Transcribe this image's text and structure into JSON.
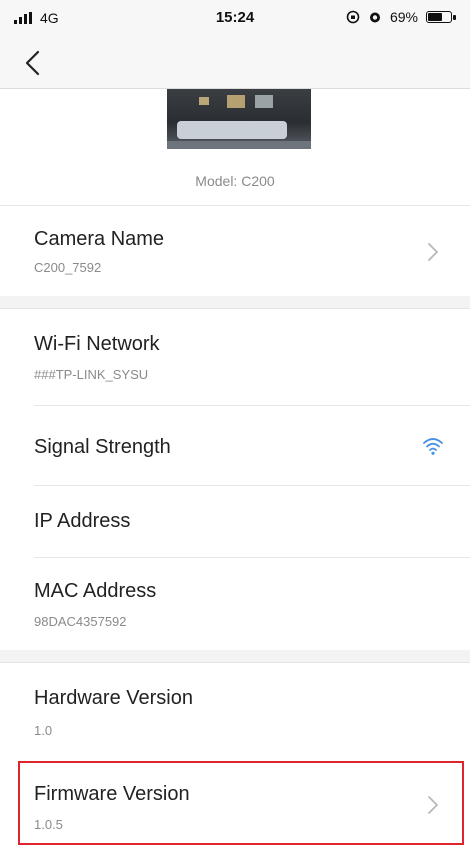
{
  "status_bar": {
    "carrier": "4G",
    "time": "15:24",
    "battery_percent": "69%",
    "battery_level": 0.69
  },
  "nav": {
    "back_icon": "chevron-left-icon"
  },
  "camera": {
    "model_label": "Model: C200"
  },
  "settings": {
    "camera_name": {
      "label": "Camera Name",
      "value": "C200_7592"
    },
    "wifi_network": {
      "label": "Wi-Fi Network",
      "value": "###TP-LINK_SYSU"
    },
    "signal_strength": {
      "label": "Signal Strength",
      "icon": "wifi-icon",
      "icon_color": "#4a90e2"
    },
    "ip_address": {
      "label": "IP Address"
    },
    "mac_address": {
      "label": "MAC Address",
      "value": "98DAC4357592"
    },
    "hardware_version": {
      "label": "Hardware Version",
      "value": "1.0"
    },
    "firmware_version": {
      "label": "Firmware Version",
      "value": "1.0.5"
    }
  },
  "colors": {
    "highlight": "#e0242d",
    "accent": "#4a90e2"
  }
}
